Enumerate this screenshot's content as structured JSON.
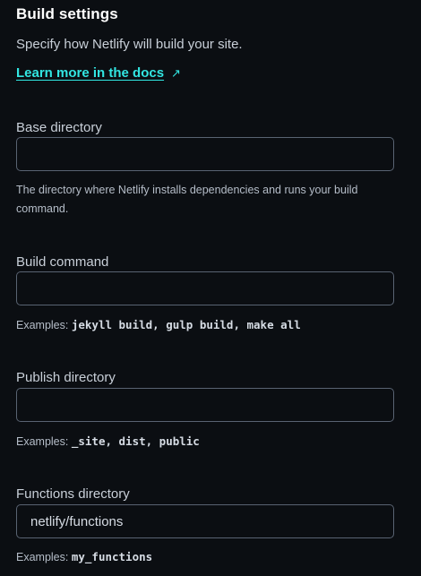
{
  "section": {
    "title": "Build settings",
    "subtitle": "Specify how Netlify will build your site.",
    "docs_link": "Learn more in the docs",
    "docs_link_icon": "external-arrow-icon"
  },
  "fields": {
    "base_directory": {
      "label": "Base directory",
      "value": "",
      "help": "The directory where Netlify installs dependencies and runs your build command."
    },
    "build_command": {
      "label": "Build command",
      "value": "",
      "help_prefix": "Examples:",
      "help_examples": "jekyll build, gulp build, make all"
    },
    "publish_directory": {
      "label": "Publish directory",
      "value": "",
      "help_prefix": "Examples:",
      "help_examples": "_site, dist, public"
    },
    "functions_directory": {
      "label": "Functions directory",
      "value": "netlify/functions",
      "help_prefix": "Examples:",
      "help_examples": "my_functions"
    }
  },
  "colors": {
    "background": "#0b0e12",
    "link": "#32e6e2",
    "input_border": "#596372"
  }
}
